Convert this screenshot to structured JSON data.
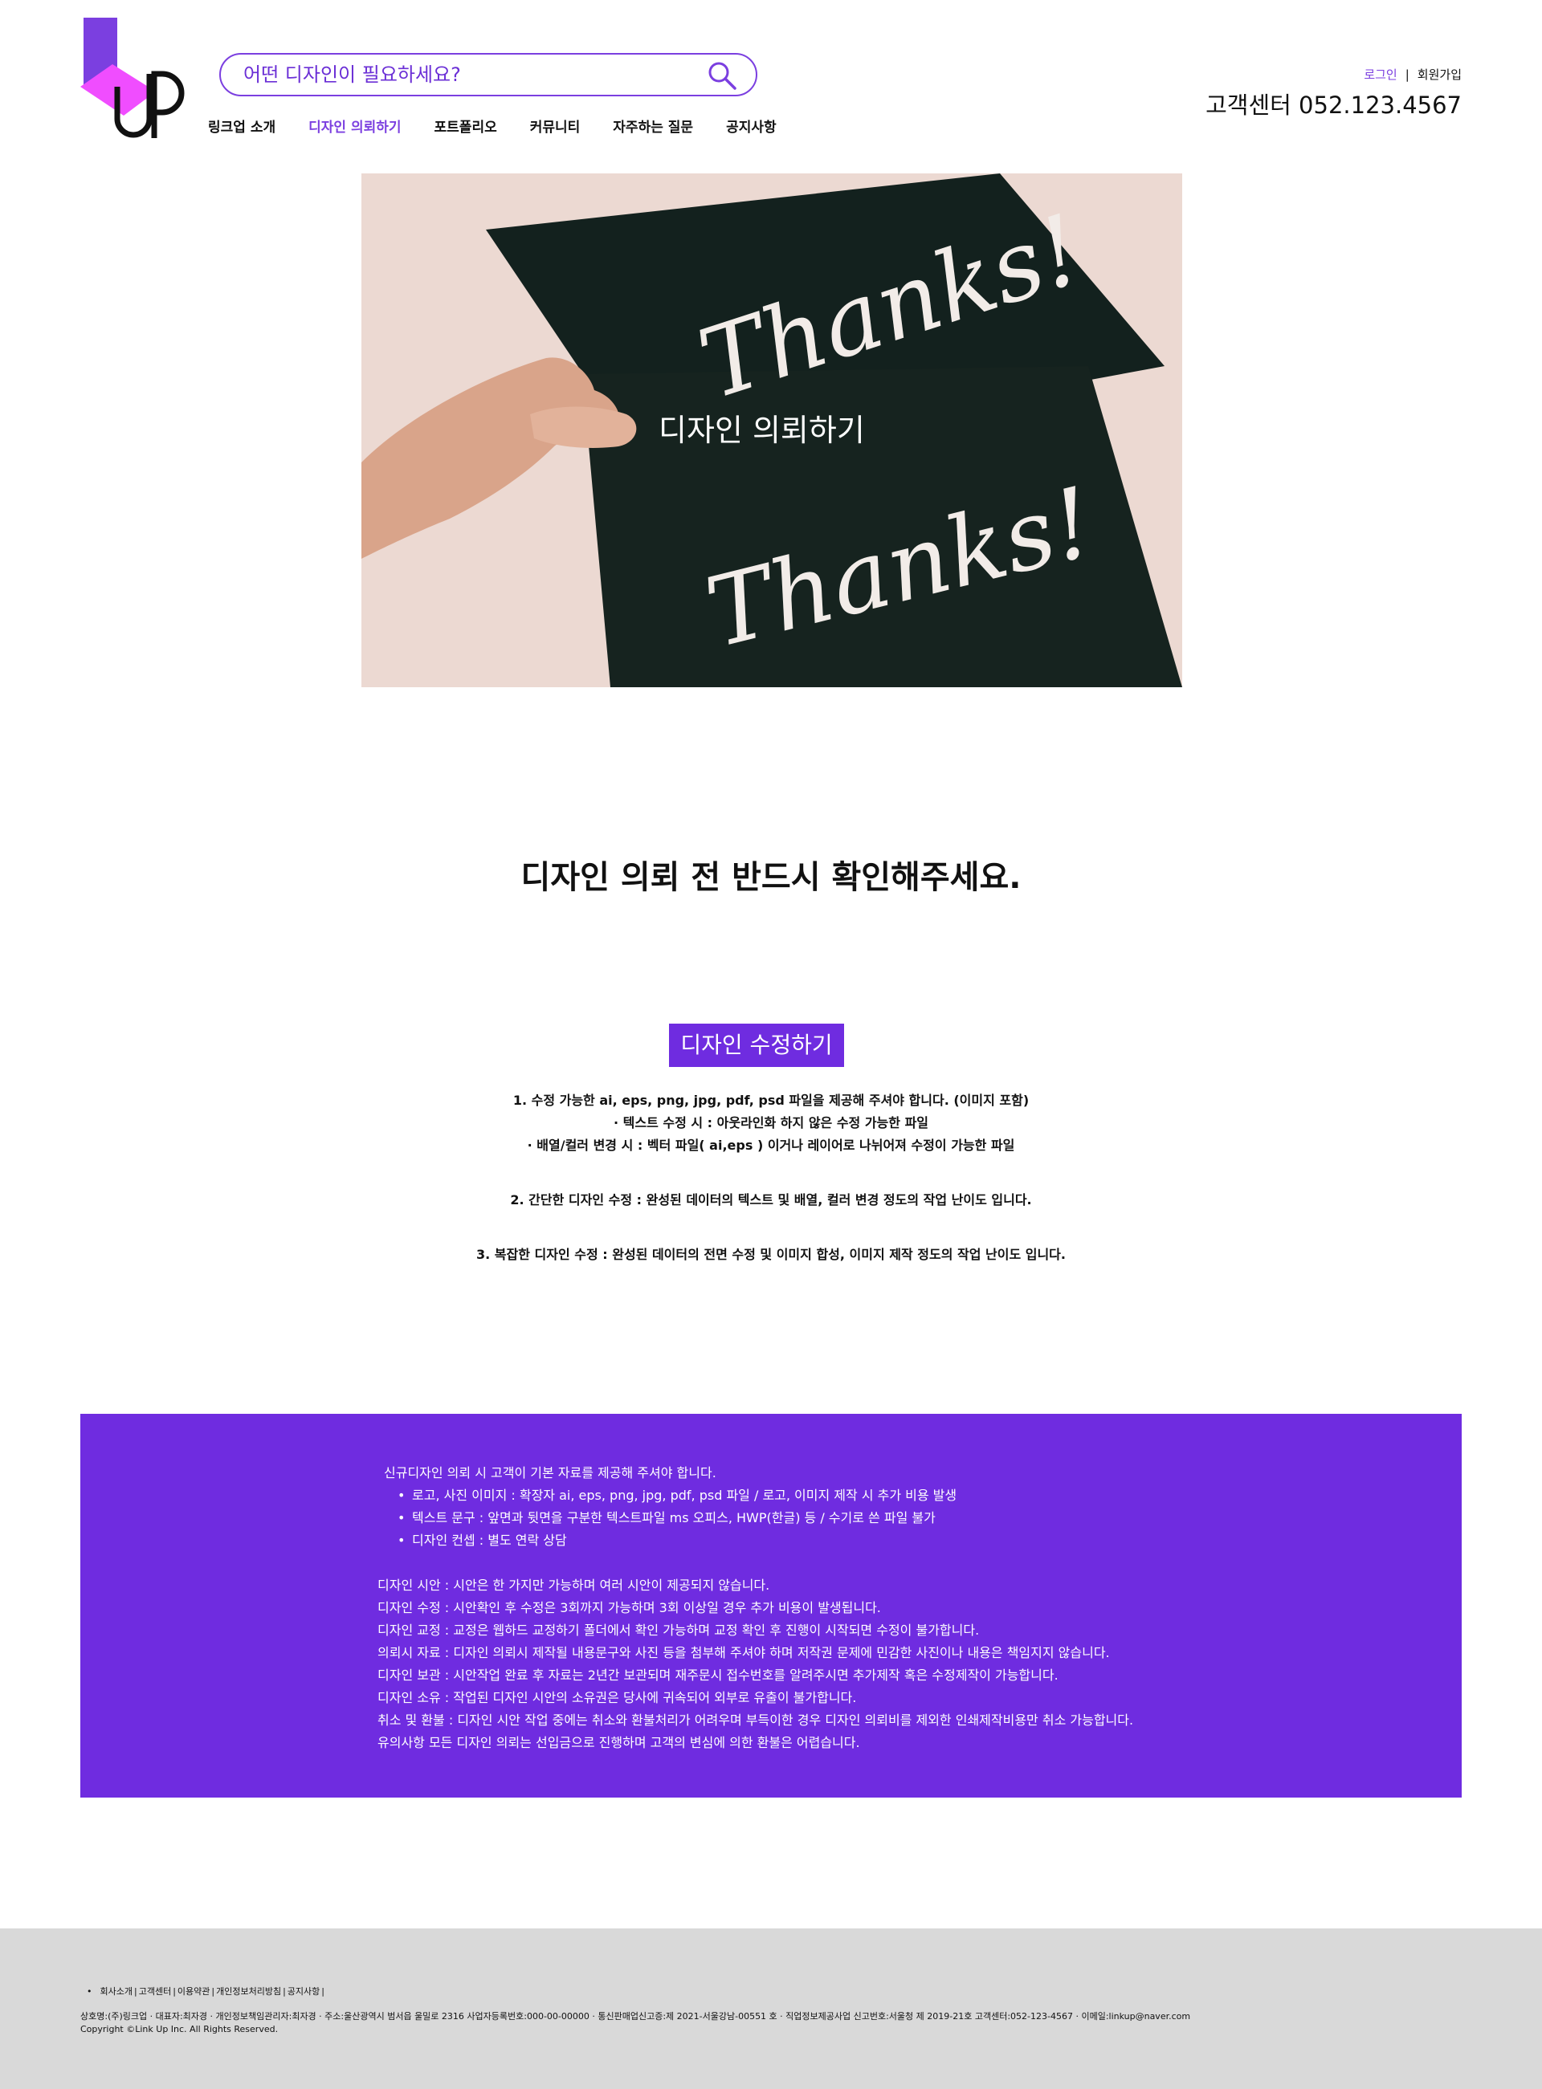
{
  "header": {
    "search_placeholder": "어떤 디자인이 필요하세요?",
    "nav": [
      "링크업 소개",
      "디자인 의뢰하기",
      "포트폴리오",
      "커뮤니티",
      "자주하는 질문",
      "공지사항"
    ],
    "login": "로그인",
    "separator": "|",
    "join": "회원가입",
    "customer_center": "고객센터 052.123.4567"
  },
  "hero": {
    "title": "디자인 의뢰하기",
    "card_text": "Thanks!"
  },
  "notice": {
    "title": "디자인 의뢰 전 반드시 확인해주세요.",
    "badge": "디자인 수정하기",
    "item1": "1. 수정 가능한 ai, eps, png, jpg, pdf, psd 파일을 제공해 주셔야 합니다. (이미지 포함)",
    "item1_sub1": "· 텍스트 수정 시 : 아웃라인화 하지 않은 수정 가능한 파일",
    "item1_sub2": "· 배열/컬러 변경 시 : 벡터 파일( ai,eps ) 이거나 레이어로 나뉘어져 수정이 가능한 파일",
    "item2": "2. 간단한 디자인 수정 : 완성된 데이터의 텍스트 및 배열, 컬러 변경 정도의 작업 난이도 입니다.",
    "item3": "3. 복잡한 디자인 수정 : 완성된 데이터의 전면 수정 및 이미지 합성, 이미지 제작 정도의 작업 난이도 입니다."
  },
  "info": {
    "heading": "신규디자인 의뢰 시 고객이 기본 자료를 제공해 주셔야 합니다.",
    "bullets": [
      "로고, 사진 이미지 : 확장자 ai, eps, png, jpg, pdf, psd 파일 / 로고, 이미지 제작 시 추가 비용 발생",
      "텍스트 문구 : 앞면과 뒷면을 구분한 텍스트파일 ms 오피스, HWP(한글) 등 / 수기로 쓴 파일 불가",
      "디자인 컨셉 : 별도 연락 상담"
    ],
    "lines": [
      "디자인 시안 : 시안은 한 가지만 가능하며 여러 시안이 제공되지 않습니다.",
      "디자인 수정 : 시안확인 후 수정은 3회까지 가능하며 3회 이상일 경우 추가 비용이 발생됩니다.",
      "디자인 교정 : 교정은 웹하드 교정하기 폴더에서 확인 가능하며 교정 확인 후 진행이 시작되면 수정이 불가합니다.",
      "의뢰시 자료 : 디자인 의뢰시 제작될 내용문구와 사진 등을 첨부해 주셔야 하며 저작권 문제에 민감한 사진이나 내용은 책임지지 않습니다.",
      "디자인 보관 : 시안작업 완료 후 자료는 2년간 보관되며 재주문시 접수번호를 알려주시면 추가제작 혹은 수정제작이 가능합니다.",
      "디자인 소유 : 작업된 디자인 시안의 소유권은 당사에 귀속되어 외부로 유출이 불가합니다.",
      "취소 및 환불 : 디자인 시안 작업 중에는 취소와 환불처리가 어려우며 부득이한 경우 디자인 의뢰비를 제외한 인쇄제작비용만 취소 가능합니다.",
      "유의사항 모든 디자인 의뢰는 선입금으로 진행하며 고객의 변심에 의한 환불은 어렵습니다."
    ]
  },
  "footer": {
    "bullet": "•",
    "sep": "|",
    "links": [
      "회사소개",
      "고객센터",
      "이용약관",
      "개인정보처리방침",
      "공지사항"
    ],
    "info_line": "상호명:(주)링크업 · 대표자:최자경 · 개인정보책임관리자:최자경 · 주소:울산광역시 범서읍 울밀로 2316 사업자등록번호:000-00-00000 · 통신판매업신고증:제 2021-서울강남-00551 호 · 직업정보제공사업 신고번호:서울청 제 2019-21호 고객센터:052-123-4567 · 이메일:linkup@naver.com",
    "copyright": "Copyright ©Link Up Inc. All Rights Reserved."
  },
  "colors": {
    "accent": "#7b3fe0",
    "info_bg": "#6f2ce0",
    "logo_magenta": "#f04dff",
    "footer_bg": "#d9d9d9"
  }
}
